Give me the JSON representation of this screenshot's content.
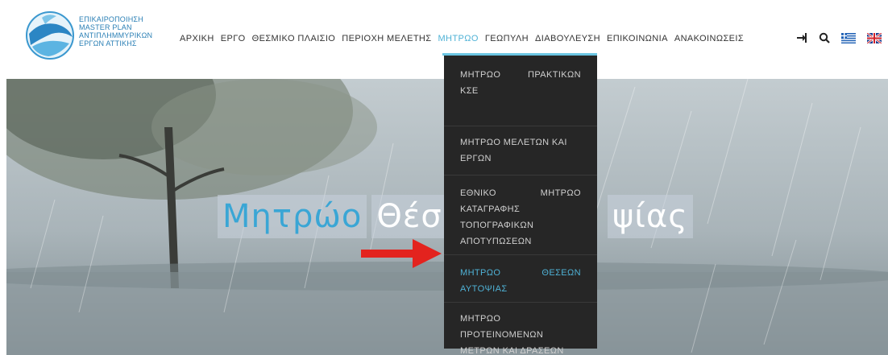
{
  "logo": {
    "lines": [
      "ΕΠΙΚΑΙΡΟΠΟΙΗΣΗ",
      "MASTER PLAN",
      "ΑΝΤΙΠΛΗΜΜΥΡΙΚΩΝ",
      "ΕΡΓΩΝ ΑΤΤΙΚΗΣ"
    ]
  },
  "nav": {
    "items": [
      "ΑΡΧΙΚΗ",
      "ΕΡΓΟ",
      "ΘΕΣΜΙΚΟ ΠΛΑΙΣΙΟ",
      "ΠΕΡΙΟΧΗ ΜΕΛΕΤΗΣ",
      "ΜΗΤΡΩΟ",
      "ΓΕΩΠΥΛΗ",
      "ΔΙΑΒΟΥΛΕΥΣΗ",
      "ΕΠΙΚΟΙΝΩΝΙΑ",
      "ΑΝΑΚΟΙΝΩΣΕΙΣ"
    ],
    "active": "ΜΗΤΡΩΟ"
  },
  "icons": [
    "login-icon",
    "search-icon",
    "greek-flag-icon",
    "uk-flag-icon"
  ],
  "hero": {
    "title_part1": "Μητρώο",
    "title_part2": "Θέσ",
    "title_part3": "ψίας"
  },
  "dropdown": {
    "items": [
      {
        "lines": [
          [
            "ΜΗΤΡΩΟ",
            "ΠΡΑΚΤΙΚΩΝ"
          ],
          [
            "ΚΣΕ"
          ]
        ],
        "active": false
      },
      {
        "lines": [
          [
            "ΜΗΤΡΩΟ ΜΕΛΕΤΩΝ ΚΑΙ"
          ],
          [
            "ΕΡΓΩΝ"
          ]
        ],
        "active": false
      },
      {
        "lines": [
          [
            "ΕΘΝΙΚΟ",
            "ΜΗΤΡΩΟ"
          ],
          [
            "ΚΑΤΑΓΡΑΦΗΣ"
          ],
          [
            "ΤΟΠΟΓΡΑΦΙΚΩΝ"
          ],
          [
            "ΑΠΟΤΥΠΩΣΕΩΝ"
          ]
        ],
        "active": false
      },
      {
        "lines": [
          [
            "ΜΗΤΡΩΟ",
            "ΘΕΣΕΩΝ"
          ],
          [
            "ΑΥΤΟΨΙΑΣ"
          ]
        ],
        "active": true
      },
      {
        "lines": [
          [
            "ΜΗΤΡΩΟ"
          ],
          [
            "ΠΡΟΤΕΙΝΟΜΕΝΩΝ"
          ],
          [
            "ΜΕΤΡΩΝ ΚΑΙ ΔΡΑΣΕΩΝ"
          ]
        ],
        "active": false
      }
    ]
  },
  "colors": {
    "accent": "#4fb2d6",
    "dropdown_bg": "#262626",
    "arrow": "#e3231e"
  }
}
